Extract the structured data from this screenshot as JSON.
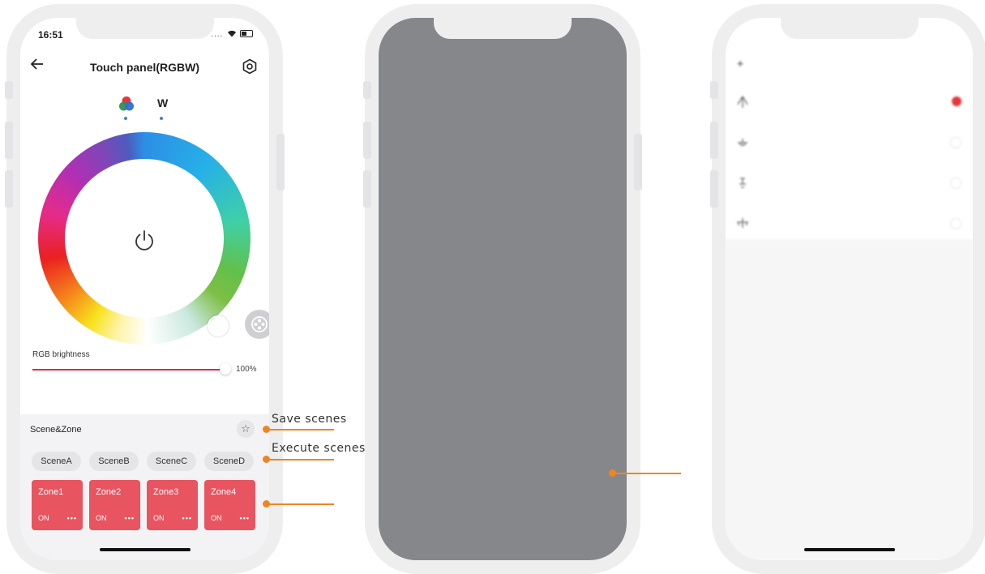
{
  "phone1": {
    "status": {
      "time": "16:51",
      "right": "...."
    },
    "nav": {
      "title": "Touch panel(RGBW)"
    },
    "mode_tabs": {
      "white_label": "W"
    },
    "brightness": {
      "label": "RGB brightness",
      "value_label": "100%",
      "value_fraction": 1.0
    },
    "scene": {
      "title": "Scene&Zone",
      "scenes": [
        "SceneA",
        "SceneB",
        "SceneC",
        "SceneD"
      ],
      "zones": [
        {
          "name": "Zone1",
          "state": "ON",
          "more": "•••"
        },
        {
          "name": "Zone2",
          "state": "ON",
          "more": "•••"
        },
        {
          "name": "Zone3",
          "state": "ON",
          "more": "•••"
        },
        {
          "name": "Zone4",
          "state": "ON",
          "more": "•••"
        }
      ]
    },
    "accent_color": "#e0264f",
    "zone_color": "#e8545f"
  },
  "annotations": {
    "save_scenes": "Save scenes",
    "execute_scenes": "Execute scenes",
    "color": "#f0851f"
  },
  "phone2": {
    "screen_color": "#86878a"
  },
  "phone3": {
    "icons": [
      "lamp-icon",
      "crystal-light-icon",
      "spot-light-icon",
      "chandelier-icon"
    ]
  }
}
